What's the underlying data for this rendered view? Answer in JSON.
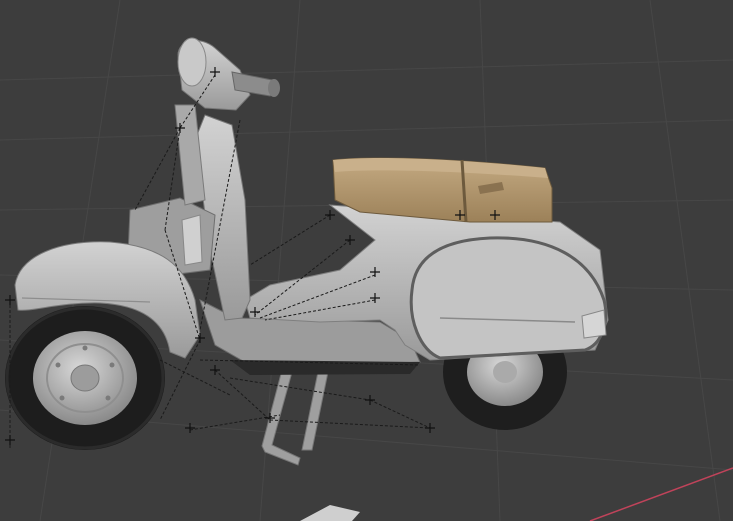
{
  "viewport": {
    "background": "#3d3d3d",
    "grid_color": "#4a4a4a",
    "x_axis_color": "#c0435a"
  },
  "model": {
    "body_color": "#bdbdbd",
    "body_shadow": "#8e8e8e",
    "seat_color": "#b59a72",
    "tire_color": "#1e1e1e",
    "rig_line_color": "#1a1a1a"
  },
  "icons": [
    "rig-handle-icon"
  ]
}
